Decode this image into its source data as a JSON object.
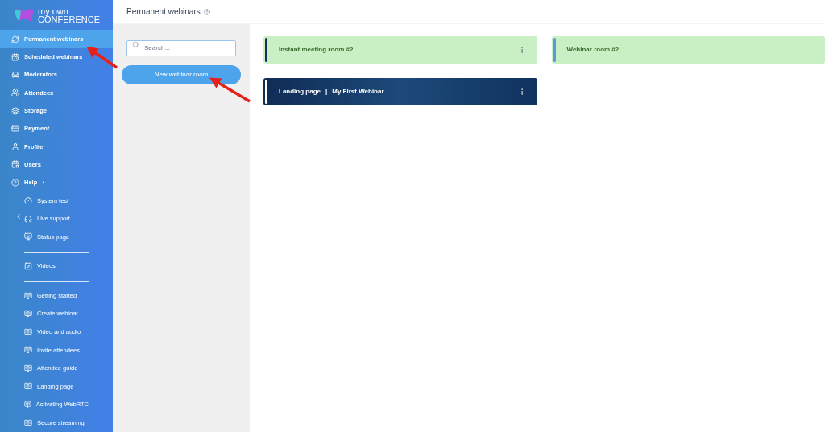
{
  "logo": {
    "line_1": "my own",
    "line_2": "CONFERENCE"
  },
  "nav": {
    "items": [
      {
        "label": "Permanent webinars",
        "selected": true
      },
      {
        "label": "Scheduled webinars",
        "selected": false
      },
      {
        "label": "Moderators",
        "selected": false
      },
      {
        "label": "Attendees",
        "selected": false
      },
      {
        "label": "Storage",
        "selected": false
      },
      {
        "label": "Payment",
        "selected": false
      },
      {
        "label": "Profile",
        "selected": false
      },
      {
        "label": "Users",
        "selected": false
      }
    ],
    "help": {
      "label": "Help",
      "expanded": true,
      "sections": [
        [
          "System test",
          "Live support",
          "Status page"
        ],
        [
          "Videos"
        ],
        [
          "Getting started",
          "Create webinar",
          "Video and audio",
          "Invite attendees",
          "Attendee guide",
          "Landing page",
          "Activating WebRTC",
          "Secure streaming"
        ]
      ]
    }
  },
  "header": {
    "title": "Permanent webinars"
  },
  "search": {
    "placeholder": "Search..."
  },
  "new_button": "New webinar room",
  "rooms": [
    {
      "kind": "plain",
      "title": "Instant meeting room #2",
      "color": "#16305e",
      "menu": true
    },
    {
      "kind": "plain",
      "title": "Webinar room #2",
      "color": "#5b9bd5",
      "menu": false
    },
    {
      "kind": "banner",
      "title": "Landing page",
      "separator": "|",
      "subtitle": "My First Webinar",
      "color": "#ffffff",
      "menu": true
    }
  ]
}
